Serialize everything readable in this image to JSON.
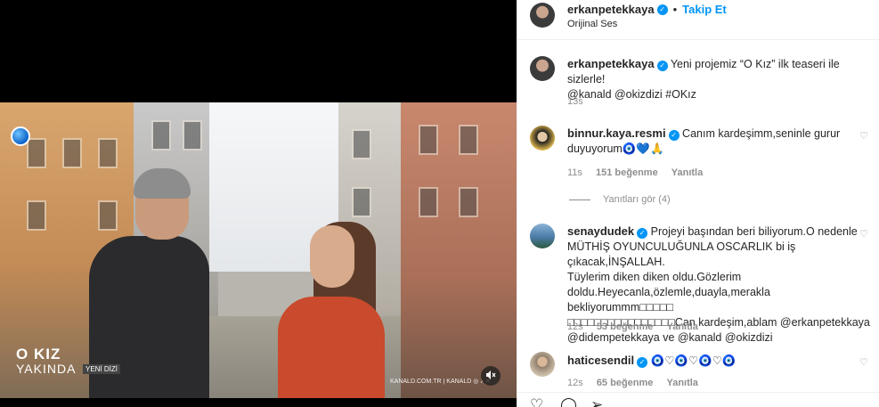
{
  "video": {
    "title": "O KIZ",
    "subtitle": "YAKINDA",
    "tag": "YENİ DİZİ",
    "watermark": "KANALD.COM.TR | KANALD ◎ ♪ ✕"
  },
  "header": {
    "username": "erkanpetekkaya",
    "follow_label": "Takip Et",
    "audio_label": "Orijinal Ses"
  },
  "caption": {
    "username": "erkanpetekkaya",
    "text_line1": "Yeni projemiz “O Kız” ilk teaseri ile sizlerle!",
    "text_line2": "@kanald @okizdizi #OKız",
    "time": "13s"
  },
  "comments": [
    {
      "username": "binnur.kaya.resmi",
      "text_line1": "Canım kardeşimm,seninle gurur",
      "text_line2": "duyuyorum🧿💙🙏",
      "time": "11s",
      "likes": "151 beğenme",
      "reply_label": "Yanıtla",
      "view_replies": "Yanıtları gör (4)"
    },
    {
      "username": "senaydudek",
      "text_line1": "Projeyi başından beri biliyorum.O nedenle",
      "text_line2": "MÜTHİŞ OYUNCULUĞUNLA OSCARLIK bi iş çıkacak,İNŞALLAH.",
      "text_line3": "Tüylerim diken diken oldu.Gözlerim",
      "text_line4": "doldu.Heyecanla,özlemle,duayla,merakla bekliyorummm□□□□□",
      "text_line5": "□□□□□□□□□□□□□□□□Can kardeşim,ablam @erkanpetekkaya",
      "text_line6": "@didempetekkaya ve @kanald @okizdizi",
      "time": "12s",
      "likes": "53 beğenme",
      "reply_label": "Yanıtla"
    },
    {
      "username": "haticesendil",
      "text_line1": "🧿♡🧿♡🧿♡🧿",
      "time": "12s",
      "likes": "65 beğenme",
      "reply_label": "Yanıtla"
    }
  ],
  "icons": {
    "like": "♡",
    "comment": "◯",
    "share": "➢",
    "verified": "✓",
    "mute": "🔇"
  },
  "colors": {
    "link": "#0095f6",
    "muted": "#8e8e8e",
    "text": "#262626"
  }
}
